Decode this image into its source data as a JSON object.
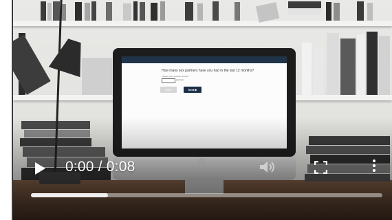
{
  "player": {
    "time_display": "0:00 / 0:08",
    "buffered_fraction": 0.22
  },
  "screen": {
    "question": "How many sex partners have you had in the last 12 months?",
    "hint": "Please enter a whole number",
    "unit": "partners",
    "back_label": "Back",
    "next_label": "Next ▶"
  },
  "colors": {
    "accent_dark": "#1a2e47",
    "control_white": "#ffffff"
  },
  "icons": {
    "play": "play-icon",
    "volume": "volume-icon",
    "fullscreen": "fullscreen-icon",
    "more": "more-vertical-icon"
  }
}
